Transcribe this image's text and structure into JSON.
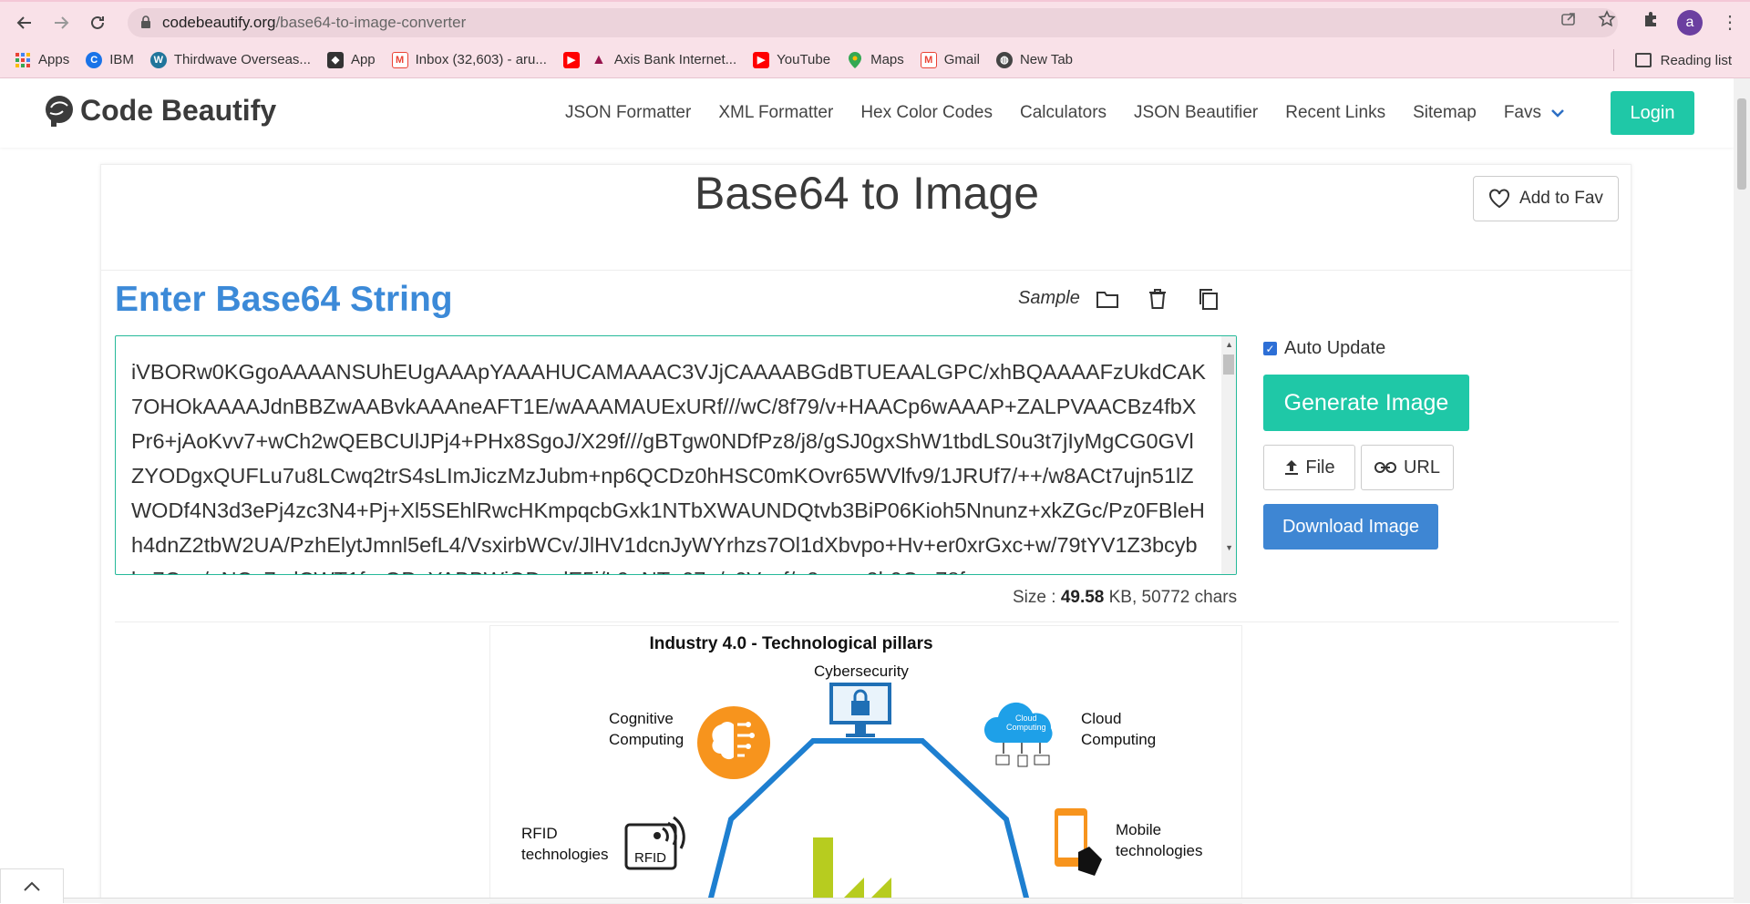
{
  "browser": {
    "url_host": "codebeautify.org",
    "url_path": "/base64-to-image-converter",
    "avatar_letter": "a",
    "bookmarks": [
      {
        "label": "Apps",
        "icon": "apps-grid-icon",
        "color": "#4285f4"
      },
      {
        "label": "IBM",
        "icon": "ibm-icon",
        "color": "#1a73e8"
      },
      {
        "label": "Thirdwave Overseas...",
        "icon": "wordpress-icon",
        "color": "#21759b"
      },
      {
        "label": "App",
        "icon": "app-icon",
        "color": "#333333"
      },
      {
        "label": "Inbox (32,603) - aru...",
        "icon": "gmail-icon",
        "color": "#ea4335"
      },
      {
        "label": "",
        "icon": "youtube-icon",
        "color": "#ff0000"
      },
      {
        "label": "Axis Bank Internet...",
        "icon": "axis-bank-icon",
        "color": "#97144d"
      },
      {
        "label": "YouTube",
        "icon": "youtube-icon",
        "color": "#ff0000"
      },
      {
        "label": "Maps",
        "icon": "maps-icon",
        "color": "#34a853"
      },
      {
        "label": "Gmail",
        "icon": "gmail-icon",
        "color": "#ea4335"
      },
      {
        "label": "New Tab",
        "icon": "globe-icon",
        "color": "#444444"
      }
    ],
    "reading_list": "Reading list"
  },
  "site": {
    "logo_text": "Code Beautify",
    "nav": [
      "JSON Formatter",
      "XML Formatter",
      "Hex Color Codes",
      "Calculators",
      "JSON Beautifier",
      "Recent Links",
      "Sitemap"
    ],
    "favs_label": "Favs",
    "login_label": "Login"
  },
  "page": {
    "title": "Base64 to Image",
    "add_fav_label": "Add to Fav",
    "section_title": "Enter Base64 String",
    "sample_label": "Sample",
    "textarea_value": "iVBORw0KGgoAAAANSUhEUgAAApYAAAHUCAMAAAC3VJjCAAAABGdBTUEAALGPC/xhBQAAAAFzUkdCAK7OHOkAAAAJdnBBZwAABvkAAAneAFT1E/wAAAMAUExURf///wC/8f79/v+HAACp6wAAAP+ZALPVAACBz4fbXPr6+jAoKvv7+wCh2wQEBCUlJPj4+PHx8SgoJ/X29f///gBTgw0NDfPz8/j8/gSJ0gxShW1tbdLS0u3t7jIyMgCG0GVlZYODgxQUFLu7u8LCwq2trS4sLImJiczMzJubm+np6QCDz0hHSC0mKOvr65WVlfv9/1JRUf7/++/w8ACt7ujn51lZWODf4N3d3ePj4zc3N4+Pj+Xl5SEhlRwcHKmpqcbGxk1NTbXWAUNDQtvb3BiP06Kioh5Nnunz+xkZGc/Pz0FBleHh4dnZ2tbW2UA/PzhElytJmnl5efL4/VsxirbWCv/JlHV1dcnJyWYrhzs7Ol1dXbvpo+Hv+er0xrGxc+w/79tYV1Z3bcybkz7Qzs/+NCg7mlCWT1f+rOP+YABBWiQDuslE5i/L9+NTn07+/y0Vynf/a2oooo2h0Cm78f+",
    "auto_update_label": "Auto Update",
    "auto_update_checked": true,
    "generate_label": "Generate Image",
    "file_label": "File",
    "url_label": "URL",
    "download_label": "Download Image",
    "size_prefix": "Size : ",
    "size_value": "49.58",
    "size_suffix": " KB, 50772 chars"
  },
  "preview": {
    "title": "Industry 4.0 - Technological pillars",
    "labels": {
      "cybersecurity": "Cybersecurity",
      "cognitive": "Cognitive\nComputing",
      "cloud": "Cloud\nComputing",
      "cloud_inner": "Cloud\nComputing",
      "rfid": "RFID\ntechnologies",
      "rfid_badge": "RFID",
      "mobile": "Mobile\ntechnologies"
    }
  },
  "colors": {
    "accent_green": "#1fc8a7",
    "title_blue": "#3c8ad8",
    "download_blue": "#3e86d3",
    "browser_pink": "#f9e1e8"
  }
}
